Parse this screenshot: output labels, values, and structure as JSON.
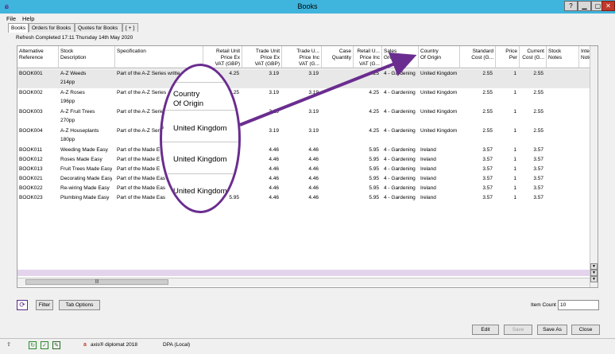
{
  "window": {
    "title": "Books"
  },
  "menu": [
    {
      "id": "file",
      "label": "File"
    },
    {
      "id": "help",
      "label": "Help"
    }
  ],
  "tabs": [
    {
      "id": "books",
      "label": "Books",
      "active": true
    },
    {
      "id": "orders",
      "label": "Orders for Books"
    },
    {
      "id": "quotes",
      "label": "Quotes for Books"
    },
    {
      "id": "add",
      "label": "[ + ]"
    }
  ],
  "refresh_text": "Refresh Completed 17:11 Thursday 14th May 2020",
  "columns": [
    {
      "key": "ref",
      "label": "Alternative\nReference"
    },
    {
      "key": "desc",
      "label": "Stock\nDescription"
    },
    {
      "key": "spec",
      "label": "Specification"
    },
    {
      "key": "retail_ex",
      "label": "Retail Unit\nPrice Ex\nVAT (GBP)"
    },
    {
      "key": "trade_ex",
      "label": "Trade Unit\nPrice Ex\nVAT (GBP)"
    },
    {
      "key": "trade_inc",
      "label": "Trade U...\nPrice Inc\nVAT (G..."
    },
    {
      "key": "case_qty",
      "label": "Case\nQuantity"
    },
    {
      "key": "retail_inc",
      "label": "Retail U...\nPrice Inc\nVAT (G..."
    },
    {
      "key": "sales_group",
      "label": "Sales\nGroup"
    },
    {
      "key": "country",
      "label": "Country\nOf Origin"
    },
    {
      "key": "std_cost",
      "label": "Standard\nCost (G..."
    },
    {
      "key": "price_per",
      "label": "Price\nPer"
    },
    {
      "key": "cur_cost",
      "label": "Current\nCost (G..."
    },
    {
      "key": "notes",
      "label": "Stock\nNotes"
    },
    {
      "key": "inter",
      "label": "Inter\nNote"
    }
  ],
  "rows": [
    {
      "ref": "BOOK001",
      "desc": "A-Z Weeds",
      "desc2": "214pp",
      "spec": "Part of the A-Z Series writte",
      "retail_ex": "4.25",
      "trade_ex": "3.19",
      "trade_inc": "3.19",
      "retail_inc": "4.25",
      "sales_group": "4 - Gardening Books",
      "country": "United Kingdom",
      "std_cost": "2.55",
      "price_per": "1",
      "cur_cost": "2.55"
    },
    {
      "ref": "BOOK002",
      "desc": "A-Z Roses",
      "desc2": "196pp",
      "spec": "Part of the A-Z Series",
      "retail_ex": "4.25",
      "trade_ex": "3.19",
      "trade_inc": "3.19",
      "retail_inc": "4.25",
      "sales_group": "4 - Gardening Books",
      "country": "United Kingdom",
      "std_cost": "2.55",
      "price_per": "1",
      "cur_cost": "2.55"
    },
    {
      "ref": "BOOK003",
      "desc": "A-Z Fruit Trees",
      "desc2": "270pp",
      "spec": "Part of the A-Z Series",
      "retail_ex": "",
      "trade_ex": "3.19",
      "trade_inc": "3.19",
      "retail_inc": "4.25",
      "sales_group": "4 - Gardening Books",
      "country": "United Kingdom",
      "std_cost": "2.55",
      "price_per": "1",
      "cur_cost": "2.55"
    },
    {
      "ref": "BOOK004",
      "desc": "A-Z Houseplants",
      "desc2": "180pp",
      "spec": "Part of the A-Z Series",
      "retail_ex": "",
      "trade_ex": "3.19",
      "trade_inc": "3.19",
      "retail_inc": "4.25",
      "sales_group": "4 - Gardening Books",
      "country": "United Kingdom",
      "std_cost": "2.55",
      "price_per": "1",
      "cur_cost": "2.55"
    },
    {
      "ref": "BOOK011",
      "desc": "Weeding Made Easy",
      "desc2": "",
      "spec": "Part of the Made E",
      "retail_ex": "",
      "trade_ex": "4.46",
      "trade_inc": "4.46",
      "retail_inc": "5.95",
      "sales_group": "4 - Gardening Books",
      "country": "Ireland",
      "std_cost": "3.57",
      "price_per": "1",
      "cur_cost": "3.57"
    },
    {
      "ref": "BOOK012",
      "desc": "Roses Made Easy",
      "desc2": "",
      "spec": "Part of the Made E",
      "retail_ex": "",
      "trade_ex": "4.46",
      "trade_inc": "4.46",
      "retail_inc": "5.95",
      "sales_group": "4 - Gardening Books",
      "country": "Ireland",
      "std_cost": "3.57",
      "price_per": "1",
      "cur_cost": "3.57"
    },
    {
      "ref": "BOOK013",
      "desc": "Fruit Trees Made Easy",
      "desc2": "",
      "spec": "Part of the Made E",
      "retail_ex": "",
      "trade_ex": "4.46",
      "trade_inc": "4.46",
      "retail_inc": "5.95",
      "sales_group": "4 - Gardening Books",
      "country": "Ireland",
      "std_cost": "3.57",
      "price_per": "1",
      "cur_cost": "3.57"
    },
    {
      "ref": "BOOK021",
      "desc": "Decorating Made Easy",
      "desc2": "",
      "spec": "Part of the Made Eas",
      "retail_ex": "",
      "trade_ex": "4.46",
      "trade_inc": "4.46",
      "retail_inc": "5.95",
      "sales_group": "4 - Gardening Books",
      "country": "Ireland",
      "std_cost": "3.57",
      "price_per": "1",
      "cur_cost": "3.57"
    },
    {
      "ref": "BOOK022",
      "desc": "Re-wiring Made Easy",
      "desc2": "",
      "spec": "Part of the Made Eas",
      "retail_ex": "",
      "trade_ex": "4.46",
      "trade_inc": "4.46",
      "retail_inc": "5.95",
      "sales_group": "4 - Gardening Books",
      "country": "Ireland",
      "std_cost": "3.57",
      "price_per": "1",
      "cur_cost": "3.57"
    },
    {
      "ref": "BOOK023",
      "desc": "Plumbing Made Easy",
      "desc2": "",
      "spec": "Part of the Made Eas",
      "retail_ex": "5.95",
      "trade_ex": "4.46",
      "trade_inc": "4.46",
      "retail_inc": "5.95",
      "sales_group": "4 - Gardening Books",
      "country": "Ireland",
      "std_cost": "3.57",
      "price_per": "1",
      "cur_cost": "3.57"
    }
  ],
  "callout": {
    "header": "Country\nOf Origin",
    "values": [
      "United Kingdom",
      "United Kingdom",
      "United Kingdom"
    ],
    "fragment_spec": "s",
    "fragment_price": "25",
    "fragment_row_a": "Eas",
    "fragment_row_b": "Eas",
    "fragment_row_c": "5.95"
  },
  "buttons": {
    "filter": "Filter",
    "tab_options": "Tab Options",
    "edit": "Edit",
    "save": "Save",
    "save_as": "Save As",
    "close": "Close"
  },
  "item_count": {
    "label": "Item Count",
    "value": "10"
  },
  "status": {
    "app": "axis® diplomat 2018",
    "db": "DPA (Local)"
  },
  "colors": {
    "titlebar": "#3fb4dc",
    "accent": "#6a2d8f",
    "selection": "#e8e8e8",
    "pink_bar": "#e3d4ec"
  }
}
